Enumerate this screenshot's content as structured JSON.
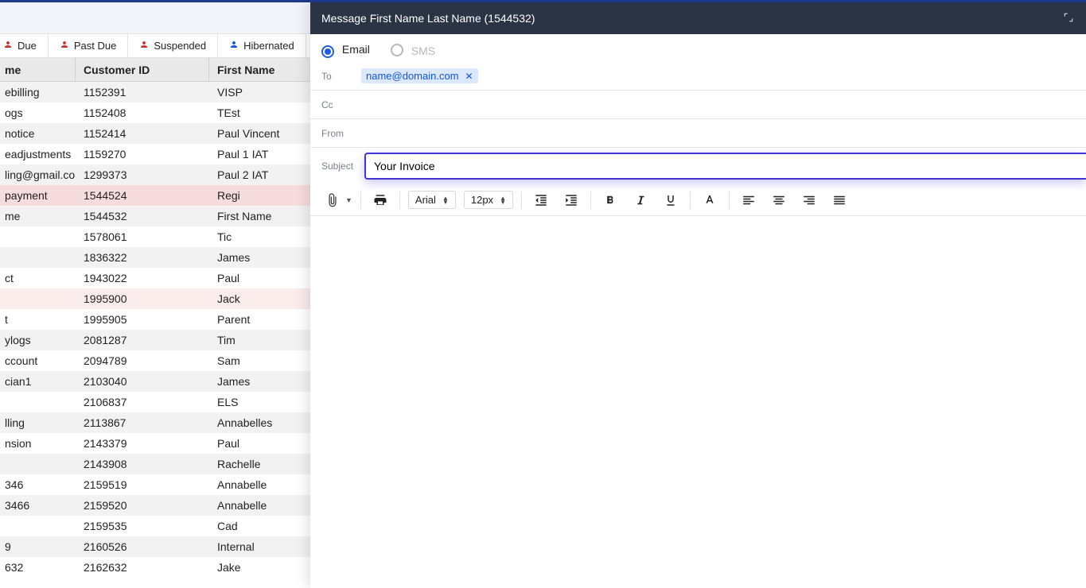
{
  "filters": {
    "due": {
      "label": "Due",
      "color": "#c9342f"
    },
    "pastdue": {
      "label": "Past Due",
      "color": "#c9342f"
    },
    "suspended": {
      "label": "Suspended",
      "color": "#c9342f"
    },
    "hibernated": {
      "label": "Hibernated",
      "color": "#1158d6"
    }
  },
  "grid": {
    "headers": {
      "name": "me",
      "id": "Customer ID",
      "fn": "First Name"
    },
    "rows": [
      {
        "name": "ebilling",
        "id": "1152391",
        "fn": "VISP",
        "tone": ""
      },
      {
        "name": "ogs",
        "id": "1152408",
        "fn": "TEst",
        "tone": ""
      },
      {
        "name": "notice",
        "id": "1152414",
        "fn": "Paul Vincent",
        "tone": ""
      },
      {
        "name": "eadjustments",
        "id": "1159270",
        "fn": "Paul 1 IAT",
        "tone": ""
      },
      {
        "name": "ling@gmail.co…",
        "id": "1299373",
        "fn": "Paul 2 IAT",
        "tone": ""
      },
      {
        "name": "payment",
        "id": "1544524",
        "fn": "Regi",
        "tone": "redish"
      },
      {
        "name": "me",
        "id": "1544532",
        "fn": "First Name",
        "tone": ""
      },
      {
        "name": "",
        "id": "1578061",
        "fn": "Tic",
        "tone": ""
      },
      {
        "name": "",
        "id": "1836322",
        "fn": "James",
        "tone": ""
      },
      {
        "name": "ct",
        "id": "1943022",
        "fn": "Paul",
        "tone": ""
      },
      {
        "name": "",
        "id": "1995900",
        "fn": "Jack",
        "tone": "pinkish"
      },
      {
        "name": "t",
        "id": "1995905",
        "fn": "Parent",
        "tone": ""
      },
      {
        "name": "ylogs",
        "id": "2081287",
        "fn": "Tim",
        "tone": ""
      },
      {
        "name": "ccount",
        "id": "2094789",
        "fn": "Sam",
        "tone": ""
      },
      {
        "name": "cian1",
        "id": "2103040",
        "fn": "James",
        "tone": ""
      },
      {
        "name": "",
        "id": "2106837",
        "fn": "ELS",
        "tone": ""
      },
      {
        "name": "lling",
        "id": "2113867",
        "fn": "Annabelles",
        "tone": ""
      },
      {
        "name": "nsion",
        "id": "2143379",
        "fn": "Paul",
        "tone": ""
      },
      {
        "name": "",
        "id": "2143908",
        "fn": "Rachelle",
        "tone": ""
      },
      {
        "name": "346",
        "id": "2159519",
        "fn": "Annabelle",
        "tone": ""
      },
      {
        "name": "3466",
        "id": "2159520",
        "fn": "Annabelle",
        "tone": ""
      },
      {
        "name": "",
        "id": "2159535",
        "fn": "Cad",
        "tone": ""
      },
      {
        "name": "9",
        "id": "2160526",
        "fn": "Internal",
        "tone": ""
      },
      {
        "name": "632",
        "id": "2162632",
        "fn": "Jake",
        "tone": ""
      }
    ]
  },
  "message": {
    "title": "Message First Name Last Name (1544532)",
    "tabs": {
      "email": "Email",
      "sms": "SMS"
    },
    "to": {
      "label": "To",
      "chip": "name@domain.com"
    },
    "cc": {
      "label": "Cc"
    },
    "from": {
      "label": "From"
    },
    "subject": {
      "label": "Subject",
      "value": "Your Invoice"
    },
    "toolbar": {
      "font": "Arial",
      "size": "12px"
    }
  }
}
